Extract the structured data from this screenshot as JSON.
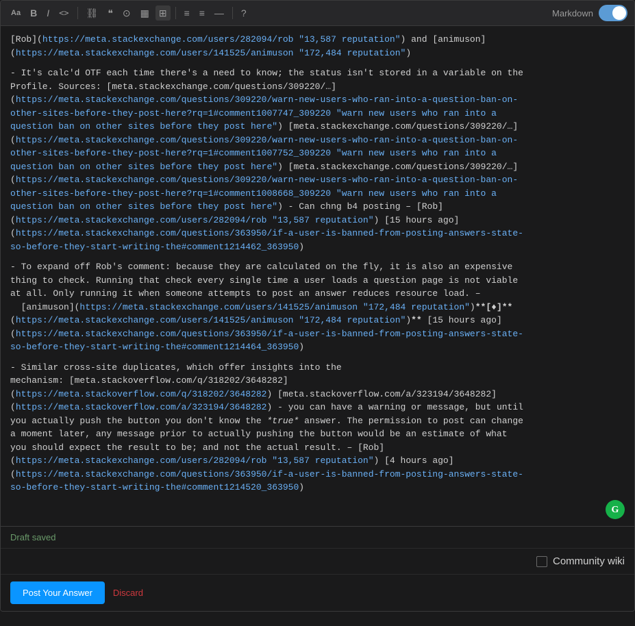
{
  "toolbar": {
    "markdown_label": "Markdown",
    "buttons": [
      {
        "id": "aa",
        "label": "Aa",
        "title": "Heading"
      },
      {
        "id": "bold",
        "label": "B",
        "title": "Bold"
      },
      {
        "id": "italic",
        "label": "I",
        "title": "Italic"
      },
      {
        "id": "code-inline",
        "label": "<>",
        "title": "Code"
      },
      {
        "id": "link",
        "label": "🔗",
        "title": "Link"
      },
      {
        "id": "blockquote",
        "label": "\"",
        "title": "Blockquote"
      },
      {
        "id": "code-block",
        "label": "{}",
        "title": "Code block"
      },
      {
        "id": "image",
        "label": "🖼",
        "title": "Image"
      },
      {
        "id": "table",
        "label": "⊞",
        "title": "Table"
      },
      {
        "id": "ordered-list",
        "label": "≡",
        "title": "Ordered list"
      },
      {
        "id": "unordered-list",
        "label": "≡",
        "title": "Unordered list"
      },
      {
        "id": "horizontal-rule",
        "label": "—",
        "title": "Horizontal rule"
      },
      {
        "id": "help",
        "label": "?",
        "title": "Help"
      }
    ]
  },
  "content": {
    "line1": "[Rob](https://meta.stackexchange.com/users/282094/rob \"13,587 reputation\") and [animuson](https://meta.stackexchange.com/users/141525/animuson \"172,484 reputation\")",
    "line2": "- It's calc'd OTF each time there's a need to know; the status isn't stored in a variable on the Profile. Sources: [meta.stackexchange.com/questions/309220/…](https://meta.stackexchange.com/questions/309220/warn-new-users-who-ran-into-a-question-ban-on-other-sites-before-they-post-here?rq=1#comment1007747_309220 \"warn new users who ran into a question ban on other sites before they post here\") [meta.stackexchange.com/questions/309220/…](https://meta.stackexchange.com/questions/309220/warn-new-users-who-ran-into-a-question-ban-on-other-sites-before-they-post-here?rq=1#comment1007752_309220 \"warn new users who ran into a question ban on other sites before they post here\") [meta.stackexchange.com/questions/309220/…](https://meta.stackexchange.com/questions/309220/warn-new-users-who-ran-into-a-question-ban-on-other-sites-before-they-post-here?rq=1#comment1008668_309220 \"warn new users who ran into a question ban on other sites before they post here\") - Can chng b4 posting – [Rob](https://meta.stackexchange.com/users/282094/rob \"13,587 reputation\") [15 hours ago] (https://meta.stackexchange.com/questions/363950/if-a-user-is-banned-from-posting-answers-state-so-before-they-start-writing-the#comment1214462_363950)",
    "line3": "- To expand off Rob's comment: because they are calculated on the fly, it is also an expensive thing to check. Running that check every single time a user loads a question page is not viable at all. Only running it when someone attempts to post an answer reduces resource load. – [animuson](https://meta.stackexchange.com/users/141525/animuson \"172,484 reputation\")**[♦]**(https://meta.stackexchange.com/users/141525/animuson \"172,484 reputation\")** [15 hours ago] (https://meta.stackexchange.com/questions/363950/if-a-user-is-banned-from-posting-answers-state-so-before-they-start-writing-the#comment1214464_363950)",
    "line4": "- Similar cross-site duplicates, which offer insights into the mechanism: [meta.stackoverflow.com/q/318202/3648282](https://meta.stackoverflow.com/q/318202/3648282) [meta.stackoverflow.com/a/323194/3648282](https://meta.stackoverflow.com/a/323194/3648282) - you can have a warning or message, but until you actually push the button you don't know the *true* answer. The permission to post can change a moment later, any message prior to actually pushing the button would be an estimate of what you should expect the result to be; and not the actual result. – [Rob](https://meta.stackexchange.com/users/282094/rob \"13,587 reputation\") [4 hours ago] (https://meta.stackexchange.com/questions/363950/if-a-user-is-banned-from-posting-answers-state-so-before-they-start-writing-the#comment1214520_363950)"
  },
  "draft_status": "Draft saved",
  "community_wiki_label": "Community wiki",
  "post_button_label": "Post Your Answer",
  "discard_link_label": "Discard",
  "grammarly_letter": "G"
}
